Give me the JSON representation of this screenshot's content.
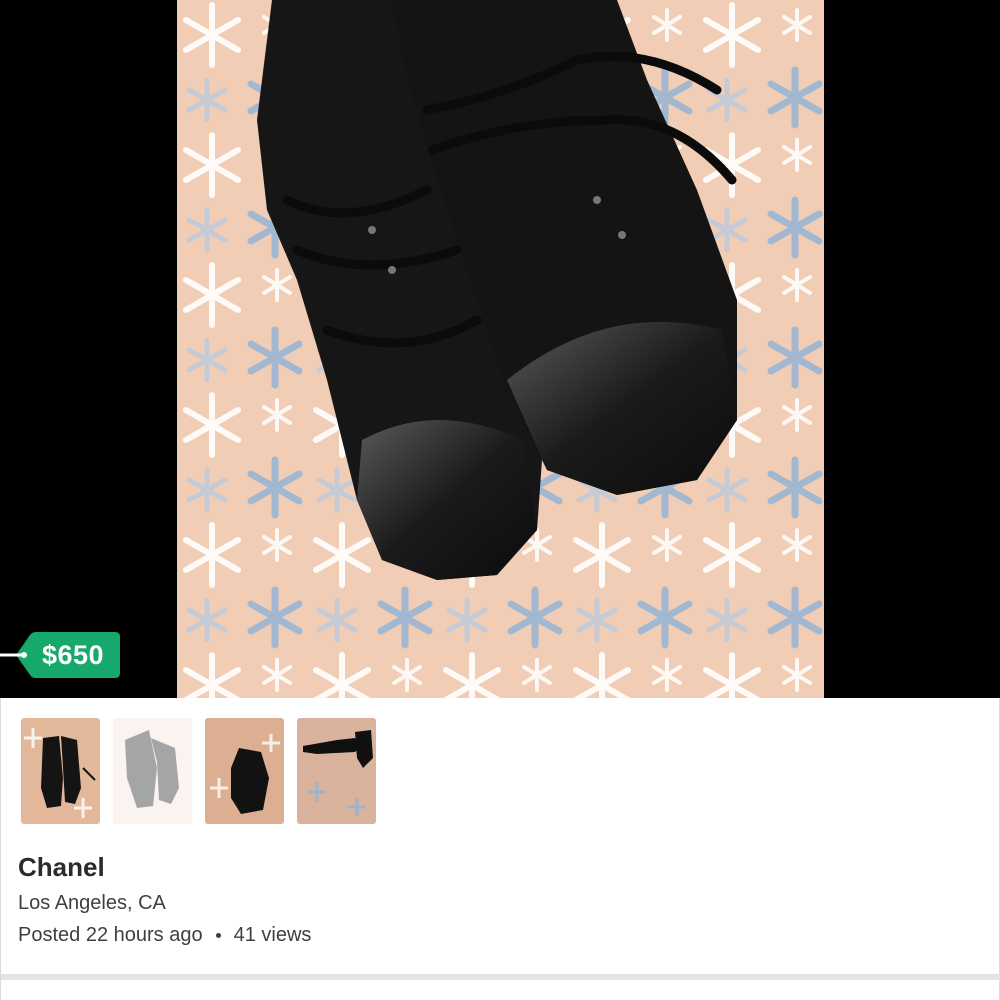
{
  "listing": {
    "price": "$650",
    "title": "Chanel",
    "location": "Los Angeles, CA",
    "posted": "Posted 22 hours ago",
    "views": "41 views"
  },
  "hero_image": {
    "icon": "black-leather-lace-up-shoes-photo",
    "colors": {
      "background": "#f3d2ba",
      "snowflake_blue": "#8fb3d9",
      "snowflake_white": "#ffffff",
      "shoe": "#151515"
    }
  },
  "thumbnails": [
    {
      "icon": "shoes-top-view-thumbnail",
      "selected": true
    },
    {
      "icon": "shoes-top-view-thumbnail",
      "selected": false
    },
    {
      "icon": "single-shoe-thumbnail",
      "selected": false
    },
    {
      "icon": "shoe-side-view-thumbnail",
      "selected": false
    }
  ],
  "colors": {
    "price_tag": "#17a96b",
    "text": "#2b2b2b",
    "divider": "#e4e4e4"
  }
}
